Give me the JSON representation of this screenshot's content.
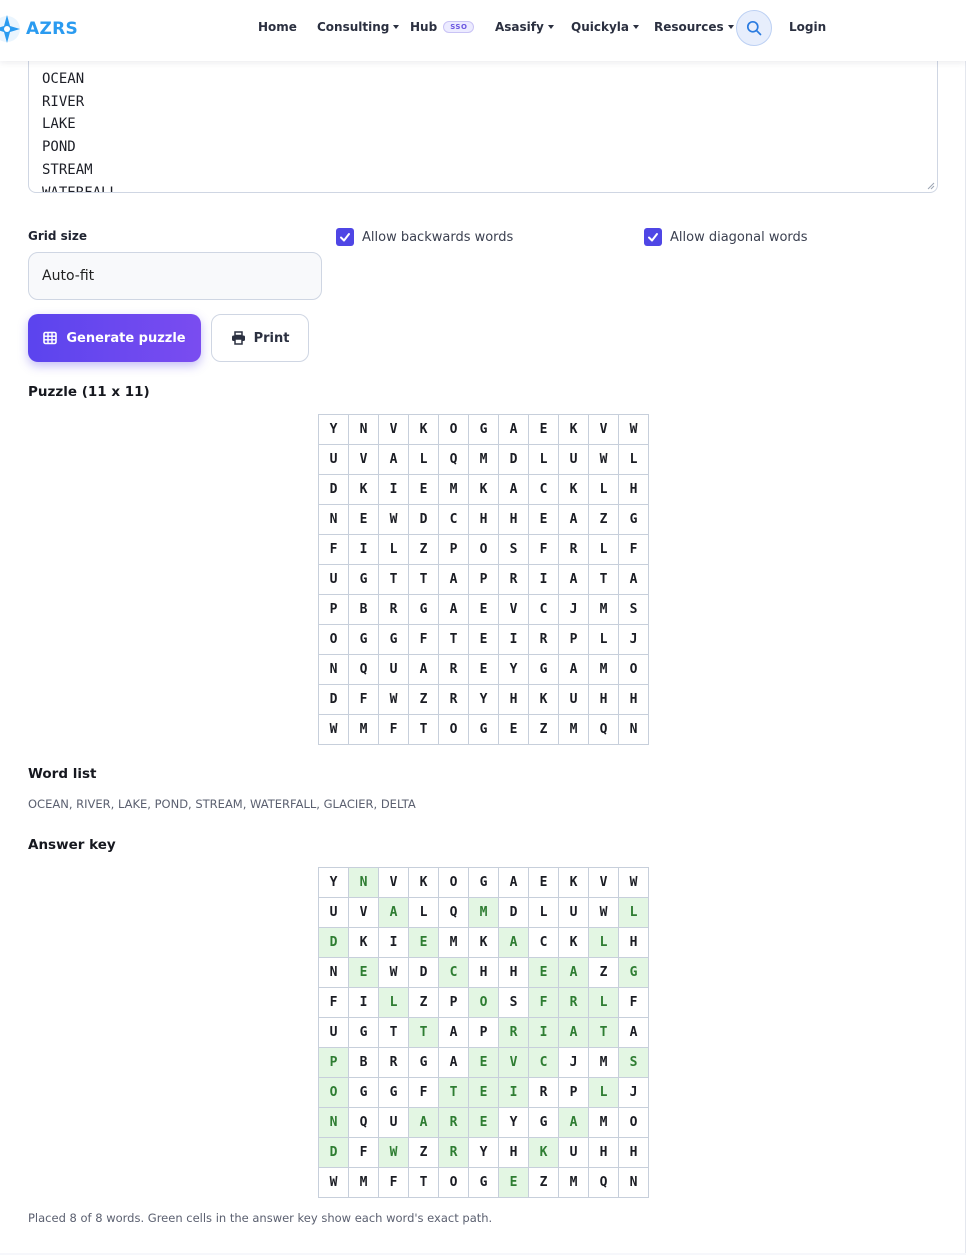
{
  "navbar": {
    "brand": "AZRS",
    "items": [
      {
        "label": "Home",
        "dropdown": false
      },
      {
        "label": "Consulting",
        "dropdown": true
      },
      {
        "label": "Hub",
        "dropdown": false,
        "badge": "SSO"
      },
      {
        "label": "Asasify",
        "dropdown": true
      },
      {
        "label": "Quickyla",
        "dropdown": true
      },
      {
        "label": "Resources",
        "dropdown": true
      }
    ],
    "search_icon": "search-icon",
    "login_label": "Login"
  },
  "words_input": {
    "lines": [
      "OCEAN",
      "RIVER",
      "LAKE",
      "POND",
      "STREAM",
      "WATERFALL"
    ]
  },
  "options": {
    "grid_size_label": "Grid size",
    "grid_size_value": "Auto-fit",
    "backwards_label": "Allow backwards words",
    "backwards_checked": true,
    "diagonal_label": "Allow diagonal words",
    "diagonal_checked": true
  },
  "buttons": {
    "generate_label": "Generate puzzle",
    "print_label": "Print"
  },
  "puzzle": {
    "title": "Puzzle (11 x 11)",
    "rows": [
      "YNVKOGAEKVW",
      "UVALQMDLUWL",
      "DKIEMKACKLH",
      "NEWDCHHEAZG",
      "FILZPOSFRLF",
      "UGTTAPRIATA",
      "PBRGAEVCJMS",
      "OGGFTEIRPLJ",
      "NQUAREYGAMO",
      "DFWZRYHKUHH",
      "WMFTOGEZMQN"
    ]
  },
  "word_list": {
    "title": "Word list",
    "text": "OCEAN, RIVER, LAKE, POND, STREAM, WATERFALL, GLACIER, DELTA"
  },
  "answer_key": {
    "title": "Answer key",
    "highlight_color": "#e3f6e3",
    "highlight_text_color": "#2e7d32",
    "highlights": [
      [
        1
      ],
      [
        2,
        5,
        10
      ],
      [
        0,
        3,
        6,
        9
      ],
      [
        1,
        4,
        7,
        8,
        10
      ],
      [
        2,
        5,
        7,
        8,
        9
      ],
      [
        3,
        6,
        7,
        8,
        9
      ],
      [
        0,
        5,
        6,
        7,
        10
      ],
      [
        0,
        4,
        5,
        6,
        9
      ],
      [
        0,
        3,
        4,
        5,
        8
      ],
      [
        0,
        2,
        4,
        7
      ],
      [
        6
      ]
    ]
  },
  "footnote": "Placed 8 of 8 words. Green cells in the answer key show each word's exact path.",
  "colors": {
    "accent": "#5b44ee",
    "brand": "#2a9bf0"
  }
}
